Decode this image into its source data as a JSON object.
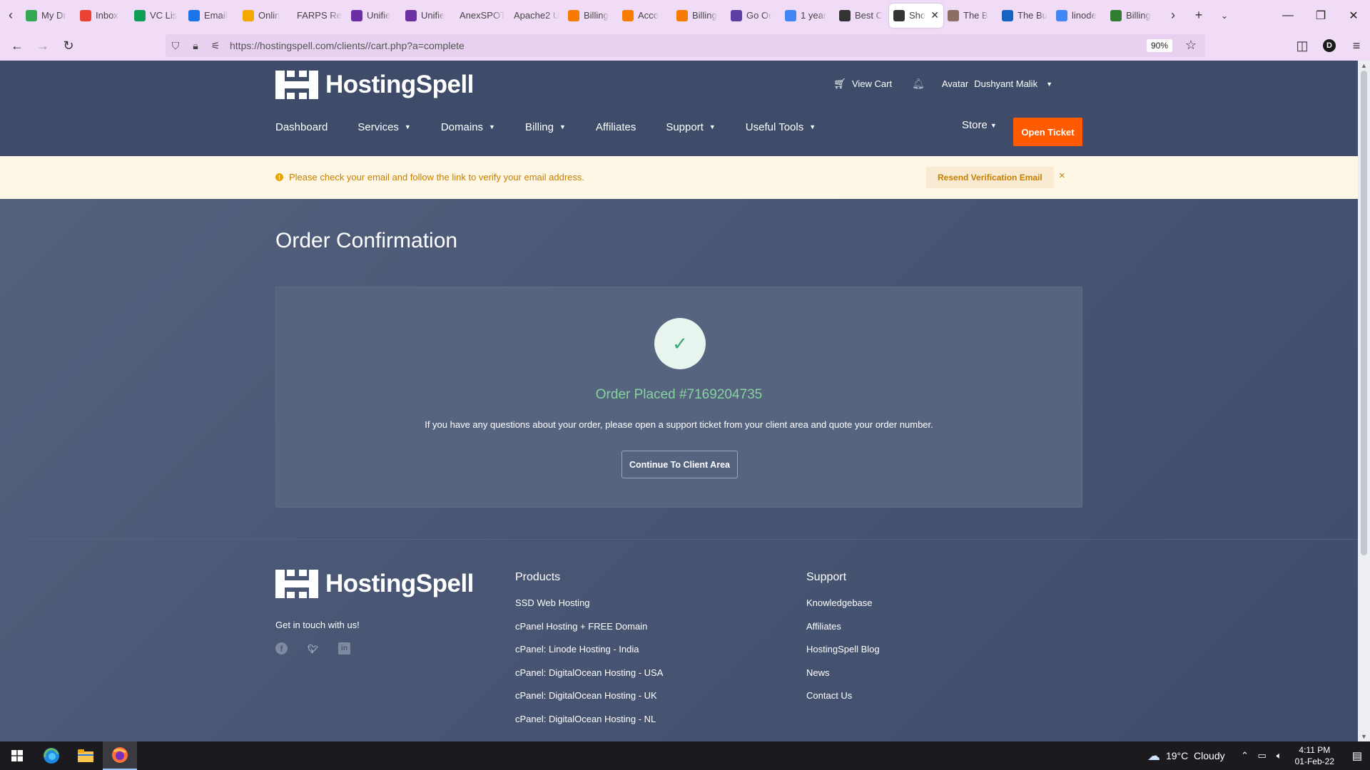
{
  "browser": {
    "tabs": [
      {
        "title": "My Dr",
        "icon": "google-drive-icon",
        "color": "#34a853"
      },
      {
        "title": "Inbox",
        "icon": "gmail-icon",
        "color": "#ea4335"
      },
      {
        "title": "VC Lis",
        "icon": "sheets-icon",
        "color": "#0f9d58"
      },
      {
        "title": "Email",
        "icon": "email-icon",
        "color": "#1a73e8"
      },
      {
        "title": "Onlin",
        "icon": "person-icon",
        "color": "#f2a900"
      },
      {
        "title": "FARPS Rec",
        "icon": "",
        "color": ""
      },
      {
        "title": "Unifie",
        "icon": "unified-icon",
        "color": "#6b2fa3"
      },
      {
        "title": "Unifie",
        "icon": "unified-icon",
        "color": "#6b2fa3"
      },
      {
        "title": "AnexSPOT",
        "icon": "",
        "color": ""
      },
      {
        "title": "Apache2 U",
        "icon": "",
        "color": ""
      },
      {
        "title": "Billing",
        "icon": "box-icon",
        "color": "#f57c00"
      },
      {
        "title": "Acco",
        "icon": "box-icon",
        "color": "#f57c00"
      },
      {
        "title": "Billing",
        "icon": "box-icon",
        "color": "#f57c00"
      },
      {
        "title": "Go Or",
        "icon": "go-icon",
        "color": "#5b3fa3"
      },
      {
        "title": "1 year",
        "icon": "google-icon",
        "color": "#4285f4"
      },
      {
        "title": "Best C",
        "icon": "hostingspell-icon",
        "color": "#333333"
      },
      {
        "title": "Sho",
        "icon": "hostingspell-icon",
        "color": "#333333",
        "active": true
      },
      {
        "title": "The B",
        "icon": "face-icon",
        "color": "#8d6e63"
      },
      {
        "title": "The Bu",
        "icon": "bird-icon",
        "color": "#1565c0"
      },
      {
        "title": "linode",
        "icon": "google-icon",
        "color": "#4285f4"
      },
      {
        "title": "Billing",
        "icon": "leaf-icon",
        "color": "#2e7d32"
      }
    ],
    "url": "https://hostingspell.com/clients//cart.php?a=complete",
    "zoom": "90%",
    "profile_initial": "D"
  },
  "site": {
    "logo_text": "HostingSpell",
    "header": {
      "view_cart": "View Cart",
      "avatar_label": "Avatar",
      "user_name": "Dushyant Malik"
    },
    "nav": [
      {
        "label": "Dashboard",
        "dropdown": false
      },
      {
        "label": "Services",
        "dropdown": true
      },
      {
        "label": "Domains",
        "dropdown": true
      },
      {
        "label": "Billing",
        "dropdown": true
      },
      {
        "label": "Affiliates",
        "dropdown": false
      },
      {
        "label": "Support",
        "dropdown": true
      },
      {
        "label": "Useful Tools",
        "dropdown": true
      }
    ],
    "store_label": "Store",
    "open_ticket": "Open Ticket",
    "accent_color": "#ff5a00"
  },
  "alert": {
    "message": "Please check your email and follow the link to verify your email address.",
    "button": "Resend Verification Email",
    "close": "×"
  },
  "main": {
    "page_title": "Order Confirmation",
    "order_placed": "Order Placed #7169204735",
    "info": "If you have any questions about your order, please open a support ticket from your client area and quote your order number.",
    "continue_button": "Continue To Client Area"
  },
  "footer": {
    "tagline": "Get in touch with us!",
    "socials": [
      "facebook-icon",
      "twitter-icon",
      "linkedin-icon"
    ],
    "products": {
      "title": "Products",
      "links": [
        "SSD Web Hosting",
        "cPanel Hosting + FREE Domain",
        "cPanel: Linode Hosting - India",
        "cPanel: DigitalOcean Hosting - USA",
        "cPanel: DigitalOcean Hosting - UK",
        "cPanel: DigitalOcean Hosting - NL"
      ]
    },
    "support": {
      "title": "Support",
      "links": [
        "Knowledgebase",
        "Affiliates",
        "HostingSpell Blog",
        "News",
        "Contact Us"
      ]
    }
  },
  "taskbar": {
    "weather": "19°C  Cloudy",
    "time": "4:11 PM",
    "date": "01-Feb-22"
  }
}
